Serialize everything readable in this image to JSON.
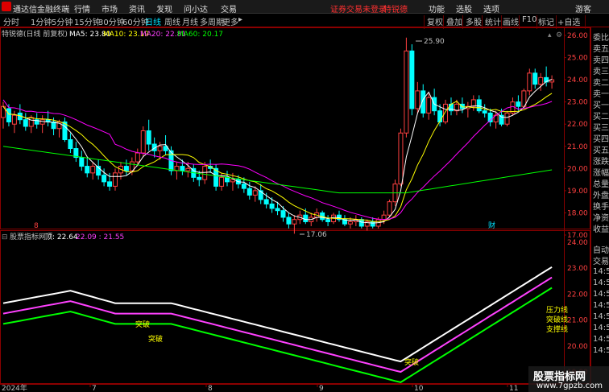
{
  "app": {
    "title": "通达信金融终端",
    "menu": [
      "行情",
      "市场",
      "资讯",
      "发现",
      "问小达",
      "交易"
    ],
    "notice": "证券交易未登录",
    "notice_stock": "特锐德",
    "right_menu": [
      "功能",
      "选股",
      "选项"
    ],
    "user": "游客"
  },
  "periods": [
    "分时",
    "1分钟",
    "5分钟",
    "15分钟",
    "30分钟",
    "60分钟",
    "日线",
    "周线",
    "月线",
    "多周期",
    "更多"
  ],
  "right_tools": [
    "复权",
    "叠加",
    "多股",
    "统计",
    "画线",
    "F10",
    "标记",
    "+自选"
  ],
  "price_header": {
    "name": "特锐德(日线 前复权)",
    "ma5": "MA5: 23.80",
    "ma10": "MA10: 23.19",
    "ma20": "MA20: 22.81",
    "ma60": "MA60: 20.17"
  },
  "indicator_header": {
    "name": "股票指标网",
    "label": "顶: 22.64",
    "values": "22.09 : 21.55"
  },
  "price_axis": [
    "26.00",
    "25.00",
    "24.00",
    "23.00",
    "22.00",
    "21.00",
    "20.00",
    "19.00",
    "18.00",
    "17.00"
  ],
  "ind_axis": [
    "24.00",
    "23.00",
    "22.00",
    "21.00",
    "20.00",
    "19.00"
  ],
  "annotations": {
    "high": "25.90",
    "low": "17.06",
    "marker_a": "8",
    "marker_b": "财",
    "break1": "突破",
    "break2": "突破",
    "break3": "突破",
    "pressure": "压力线",
    "breakout": "突破线",
    "support": "支撑线"
  },
  "dates": [
    "2024年",
    "7",
    "8",
    "9",
    "10",
    "11"
  ],
  "right_panel": [
    "委比",
    "卖五",
    "卖四",
    "卖三",
    "卖二",
    "卖一",
    "买一",
    "买二",
    "买三",
    "买四",
    "买五",
    "涨跌",
    "涨幅",
    "总量",
    "外盘",
    "换手",
    "净资",
    "收益"
  ],
  "right_panel_lower": [
    "自动",
    "交易",
    "14:5",
    "14:5",
    "14:5",
    "14:5",
    "14:5",
    "14:5",
    "14:5",
    "14:5"
  ],
  "watermark": {
    "title": "股票指标网",
    "url": "www.7gpzb.com"
  },
  "colors": {
    "up": "#ff4040",
    "down": "#00ffff",
    "ma5": "#ffffff",
    "ma10": "#ffff00",
    "ma20": "#ff00ff",
    "ma60": "#00ff00"
  },
  "chart_data": {
    "type": "candlestick",
    "ylim": [
      16.8,
      26.4
    ],
    "candles": [
      [
        22.3,
        23.0,
        21.8,
        22.8
      ],
      [
        22.7,
        22.9,
        21.9,
        22.1
      ],
      [
        22.0,
        22.6,
        21.6,
        22.4
      ],
      [
        22.5,
        22.9,
        22.0,
        22.2
      ],
      [
        22.2,
        22.5,
        21.7,
        21.9
      ],
      [
        21.9,
        22.4,
        21.6,
        22.3
      ],
      [
        22.2,
        22.5,
        21.8,
        22.0
      ],
      [
        22.0,
        22.4,
        21.6,
        22.2
      ],
      [
        22.2,
        22.6,
        21.9,
        22.1
      ],
      [
        22.1,
        22.3,
        21.5,
        21.8
      ],
      [
        21.8,
        22.2,
        21.4,
        22.1
      ],
      [
        22.1,
        22.3,
        21.2,
        21.3
      ],
      [
        21.3,
        21.6,
        20.7,
        20.9
      ],
      [
        20.9,
        21.2,
        20.3,
        20.5
      ],
      [
        20.5,
        20.8,
        19.9,
        20.1
      ],
      [
        20.1,
        20.5,
        19.6,
        19.8
      ],
      [
        19.8,
        20.3,
        19.5,
        20.1
      ],
      [
        20.1,
        20.4,
        19.5,
        19.7
      ],
      [
        19.7,
        20.0,
        19.2,
        19.4
      ],
      [
        19.4,
        19.8,
        19.0,
        19.2
      ],
      [
        19.2,
        20.0,
        19.0,
        19.8
      ],
      [
        19.8,
        20.3,
        19.5,
        20.1
      ],
      [
        20.1,
        20.4,
        19.7,
        19.9
      ],
      [
        19.9,
        20.5,
        19.7,
        20.3
      ],
      [
        20.3,
        20.9,
        20.1,
        20.7
      ],
      [
        20.7,
        21.9,
        20.5,
        21.7
      ],
      [
        21.7,
        22.2,
        20.8,
        21.1
      ],
      [
        21.1,
        21.4,
        20.5,
        20.8
      ],
      [
        20.8,
        21.2,
        20.4,
        21.0
      ],
      [
        21.0,
        21.5,
        20.6,
        20.8
      ],
      [
        20.8,
        21.0,
        19.7,
        19.9
      ],
      [
        19.9,
        20.3,
        19.5,
        20.1
      ],
      [
        20.1,
        20.4,
        19.7,
        19.9
      ],
      [
        19.9,
        20.3,
        19.6,
        20.0
      ],
      [
        20.0,
        20.2,
        19.4,
        19.6
      ],
      [
        19.6,
        19.9,
        19.2,
        19.5
      ],
      [
        19.5,
        20.3,
        19.3,
        20.1
      ],
      [
        20.1,
        20.4,
        19.8,
        20.0
      ],
      [
        20.0,
        20.2,
        19.0,
        19.2
      ],
      [
        19.2,
        19.8,
        19.0,
        19.6
      ],
      [
        19.6,
        19.9,
        19.2,
        19.4
      ],
      [
        19.4,
        19.8,
        19.0,
        19.5
      ],
      [
        19.5,
        19.7,
        19.1,
        19.3
      ],
      [
        19.3,
        19.6,
        18.9,
        19.1
      ],
      [
        19.1,
        19.4,
        18.6,
        18.8
      ],
      [
        18.8,
        19.2,
        18.5,
        19.0
      ],
      [
        19.0,
        19.3,
        18.4,
        18.6
      ],
      [
        18.6,
        18.9,
        18.2,
        18.4
      ],
      [
        18.4,
        18.7,
        18.0,
        18.2
      ],
      [
        18.2,
        18.5,
        17.9,
        18.1
      ],
      [
        18.1,
        18.3,
        17.6,
        17.8
      ],
      [
        17.8,
        18.0,
        17.3,
        17.5
      ],
      [
        17.5,
        17.9,
        17.06,
        17.7
      ],
      [
        17.7,
        18.1,
        17.5,
        17.9
      ],
      [
        17.9,
        18.2,
        17.5,
        17.6
      ],
      [
        17.6,
        18.0,
        17.4,
        17.8
      ],
      [
        17.8,
        18.2,
        17.6,
        18.0
      ],
      [
        18.0,
        18.1,
        17.6,
        17.7
      ],
      [
        17.7,
        17.9,
        17.4,
        17.6
      ],
      [
        17.6,
        18.0,
        17.5,
        17.9
      ],
      [
        17.9,
        18.1,
        17.6,
        17.7
      ],
      [
        17.7,
        17.9,
        17.4,
        17.5
      ],
      [
        17.5,
        17.8,
        17.3,
        17.6
      ],
      [
        17.6,
        17.9,
        17.4,
        17.7
      ],
      [
        17.7,
        17.8,
        17.3,
        17.4
      ],
      [
        17.4,
        17.7,
        17.2,
        17.6
      ],
      [
        17.6,
        17.8,
        17.3,
        17.4
      ],
      [
        17.4,
        17.8,
        17.3,
        17.7
      ],
      [
        17.7,
        18.1,
        17.5,
        17.9
      ],
      [
        17.9,
        18.6,
        17.8,
        18.5
      ],
      [
        18.5,
        19.5,
        18.3,
        19.3
      ],
      [
        19.3,
        21.8,
        19.2,
        21.6
      ],
      [
        21.6,
        25.9,
        21.4,
        25.3
      ],
      [
        25.3,
        25.6,
        22.4,
        22.7
      ],
      [
        22.7,
        23.9,
        22.5,
        23.5
      ],
      [
        23.5,
        23.8,
        22.3,
        22.5
      ],
      [
        22.5,
        23.4,
        22.2,
        23.2
      ],
      [
        23.2,
        23.6,
        22.4,
        22.6
      ],
      [
        22.6,
        22.9,
        21.9,
        22.1
      ],
      [
        22.1,
        23.1,
        22.0,
        22.9
      ],
      [
        22.9,
        23.2,
        22.4,
        22.6
      ],
      [
        22.6,
        23.1,
        22.4,
        22.9
      ],
      [
        22.9,
        23.2,
        22.5,
        22.7
      ],
      [
        22.7,
        23.0,
        22.3,
        22.8
      ],
      [
        22.8,
        23.3,
        22.6,
        23.1
      ],
      [
        23.1,
        23.3,
        22.5,
        22.6
      ],
      [
        22.6,
        22.9,
        22.3,
        22.5
      ],
      [
        22.5,
        22.7,
        21.9,
        22.1
      ],
      [
        22.1,
        22.6,
        21.8,
        22.4
      ],
      [
        22.4,
        22.7,
        21.9,
        22.0
      ],
      [
        22.0,
        22.6,
        21.9,
        22.5
      ],
      [
        22.5,
        23.2,
        22.4,
        23.0
      ],
      [
        23.0,
        23.3,
        22.6,
        22.8
      ],
      [
        22.8,
        23.6,
        22.7,
        23.5
      ],
      [
        23.5,
        24.5,
        23.3,
        24.3
      ],
      [
        24.3,
        24.5,
        23.6,
        23.8
      ],
      [
        23.8,
        24.3,
        23.5,
        24.1
      ],
      [
        24.1,
        24.6,
        23.7,
        23.9
      ],
      [
        23.9,
        24.2,
        23.6,
        24.0
      ]
    ]
  }
}
